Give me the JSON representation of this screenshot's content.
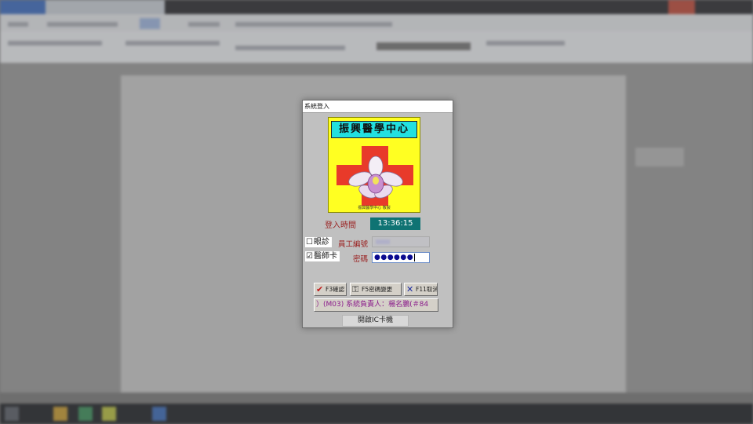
{
  "dialog": {
    "title": "系統登入",
    "logo": {
      "banner_text": "振興醫學中心",
      "caption": "振興醫學中心  敬製",
      "colors": {
        "background": "#ffff22",
        "banner": "#22e0e0",
        "cross": "#e83a2a"
      }
    },
    "login_time": {
      "label": "登入時間",
      "value": "13:36:15"
    },
    "checkboxes": [
      {
        "label": "眼診",
        "checked": false,
        "box": "☐"
      },
      {
        "label": "醫師卡",
        "checked": true,
        "box": "☑"
      }
    ],
    "employee_id": {
      "label": "員工編號",
      "value": ""
    },
    "password": {
      "label": "密碼",
      "value": "●●●●●●"
    },
    "buttons": {
      "confirm": "F3確認",
      "change_password": "F5密碼變更",
      "cancel": "F11取消"
    },
    "owner_text": "）(M03) 系統負責人：楊名鵬(＃84",
    "open_ic_button": "開啟IC卡機"
  }
}
